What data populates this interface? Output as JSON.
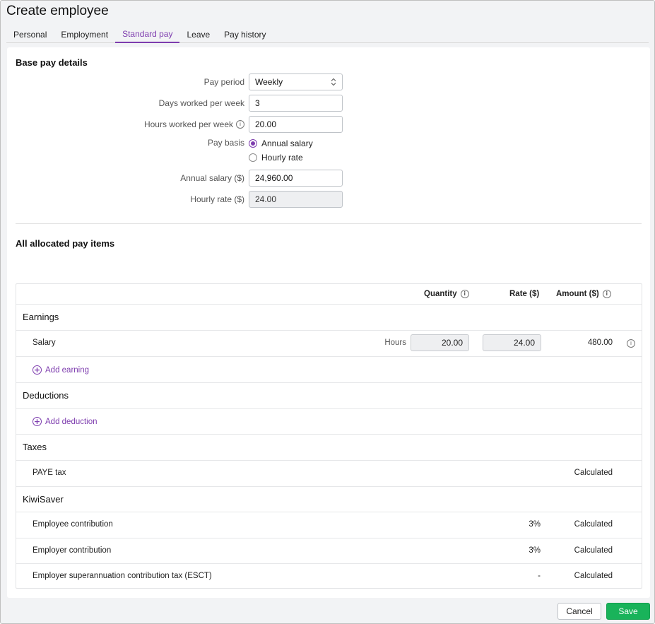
{
  "window": {
    "title": "Create employee"
  },
  "tabs": [
    {
      "label": "Personal"
    },
    {
      "label": "Employment"
    },
    {
      "label": "Standard pay",
      "active": true
    },
    {
      "label": "Leave"
    },
    {
      "label": "Pay history"
    }
  ],
  "base_pay": {
    "title": "Base pay details",
    "pay_period": {
      "label": "Pay period",
      "value": "Weekly"
    },
    "days_worked": {
      "label": "Days worked per week",
      "value": "3"
    },
    "hours_worked": {
      "label": "Hours worked per week",
      "value": "20.00"
    },
    "pay_basis": {
      "label": "Pay basis",
      "options": [
        {
          "label": "Annual salary",
          "selected": true
        },
        {
          "label": "Hourly rate",
          "selected": false
        }
      ]
    },
    "annual_salary": {
      "label": "Annual salary ($)",
      "value": "24,960.00"
    },
    "hourly_rate": {
      "label": "Hourly rate ($)",
      "value": "24.00"
    }
  },
  "pay_items": {
    "title": "All allocated pay items",
    "headers": {
      "quantity": "Quantity",
      "rate": "Rate ($)",
      "amount": "Amount ($)"
    },
    "earnings": {
      "label": "Earnings",
      "items": [
        {
          "name": "Salary",
          "unit": "Hours",
          "quantity": "20.00",
          "rate": "24.00",
          "amount": "480.00"
        }
      ],
      "add_label": "Add earning"
    },
    "deductions": {
      "label": "Deductions",
      "add_label": "Add deduction"
    },
    "taxes": {
      "label": "Taxes",
      "items": [
        {
          "name": "PAYE tax",
          "amount": "Calculated"
        }
      ]
    },
    "kiwisaver": {
      "label": "KiwiSaver",
      "items": [
        {
          "name": "Employee contribution",
          "rate": "3%",
          "amount": "Calculated"
        },
        {
          "name": "Employer contribution",
          "rate": "3%",
          "amount": "Calculated"
        },
        {
          "name": "Employer superannuation contribution tax (ESCT)",
          "rate": "-",
          "amount": "Calculated"
        }
      ]
    }
  },
  "footer": {
    "cancel_label": "Cancel",
    "save_label": "Save"
  },
  "colors": {
    "accent": "#7d3cae",
    "save": "#19b35a"
  }
}
